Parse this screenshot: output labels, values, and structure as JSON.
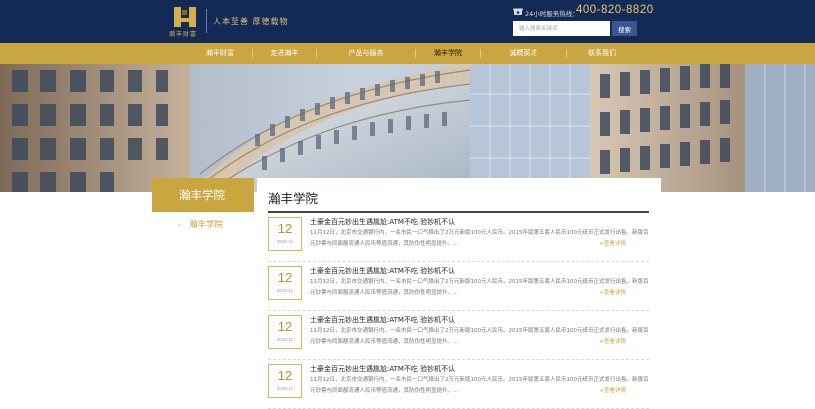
{
  "header": {
    "logo_text": "瀚丰财富",
    "slogan": "人本至善 厚德载物",
    "hotline_label": "24小时服务热线：",
    "hotline_number": "400-820-8820",
    "search_placeholder": "输入搜索关键词",
    "search_button": "搜索"
  },
  "nav": {
    "items": [
      {
        "label": "瀚丰财富"
      },
      {
        "label": "走进瀚丰"
      },
      {
        "label": "产品与服务"
      },
      {
        "label": "瀚丰学院"
      },
      {
        "label": "诚聘英才"
      },
      {
        "label": "联系我们"
      }
    ]
  },
  "sidebar": {
    "title": "瀚丰学院",
    "items": [
      {
        "chevron": "›",
        "label": "瀚丰学院"
      }
    ]
  },
  "main": {
    "title": "瀚丰学院",
    "news": [
      {
        "day": "12",
        "ym": "2015-11",
        "title": "土豪金百元钞出生遇尴尬:ATM不吃 验钞机不认",
        "summary": "11月12日，北京市交通银行内，一名市民一口气换出了2万元新版100元人民币。2015年版第五套人民币100元纸币正式发行出售。新版百元钞票与同面额流通人民币等值流通，其防伪性明显提升。...",
        "more": "+查看详情"
      },
      {
        "day": "12",
        "ym": "2015-11",
        "title": "土豪金百元钞出生遇尴尬:ATM不吃 验钞机不认",
        "summary": "11月12日，北京市交通银行内，一名市民一口气换出了2万元新版100元人民币。2015年版第五套人民币100元纸币正式发行出售。新版百元钞票与同面额流通人民币等值流通，其防伪性明显提升。...",
        "more": "+查看详情"
      },
      {
        "day": "12",
        "ym": "2015-11",
        "title": "土豪金百元钞出生遇尴尬:ATM不吃 验钞机不认",
        "summary": "11月12日，北京市交通银行内，一名市民一口气换出了2万元新版100元人民币。2015年版第五套人民币100元纸币正式发行出售。新版百元钞票与同面额流通人民币等值流通，其防伪性明显提升。...",
        "more": "+查看详情"
      },
      {
        "day": "12",
        "ym": "2015-11",
        "title": "土豪金百元钞出生遇尴尬:ATM不吃 验钞机不认",
        "summary": "11月12日，北京市交通银行内，一名市民一口气换出了2万元新版100元人民币。2015年版第五套人民币100元纸币正式发行出售。新版百元钞票与同面额流通人民币等值流通，其防伪性明显提升。...",
        "more": "+查看详情"
      }
    ]
  },
  "colors": {
    "header_bg": "#142a56",
    "accent_gold": "#c9a640",
    "search_button_bg": "#3b5590"
  },
  "icons": {
    "logo": "hanfeng-logo-icon",
    "hotline": "phone-icon",
    "sidebar_chevron": "chevron-right-icon"
  }
}
